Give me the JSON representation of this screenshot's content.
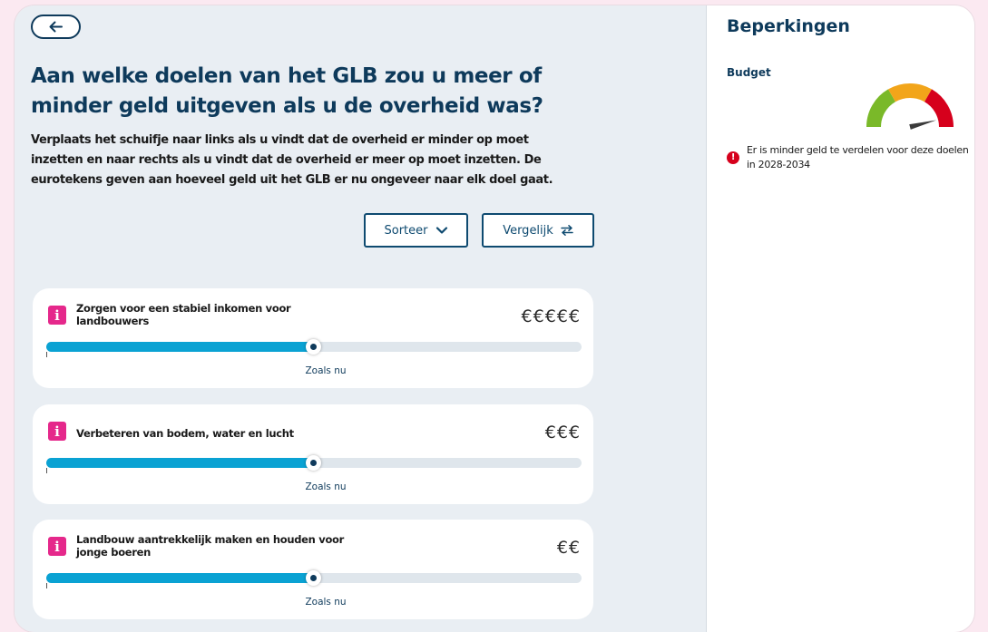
{
  "main": {
    "title": "Aan welke doelen van het GLB zou u meer of minder geld uitgeven als u de overheid was?",
    "intro": "Verplaats het schuifje naar links als u vindt dat de overheid er minder op moet inzetten en naar rechts als u vindt dat de overheid er meer op moet inzetten. De eurotekens geven aan hoeveel geld uit het GLB er nu ongeveer naar elk doel gaat.",
    "sort_label": "Sorteer",
    "compare_label": "Vergelijk",
    "goals": [
      {
        "label": "Zorgen voor een stabiel inkomen voor landbouwers",
        "euros": "€€€€€",
        "slider_value": 0.5,
        "status": "Zoals nu"
      },
      {
        "label": "Verbeteren van bodem, water en lucht",
        "euros": "€€€",
        "slider_value": 0.5,
        "status": "Zoals nu"
      },
      {
        "label": "Landbouw aantrekkelijk maken en houden voor jonge boeren",
        "euros": "€€",
        "slider_value": 0.5,
        "status": "Zoals nu"
      }
    ]
  },
  "sidebar": {
    "title": "Beperkingen",
    "budget_label": "Budget",
    "budget_level": 0.92,
    "gauge_colors": [
      "#7ab929",
      "#f2a51a",
      "#d6001c"
    ],
    "alert_text": "Er is minder geld te verdelen voor deze doelen in 2028-2034"
  },
  "icons": {
    "back": "arrow-left-icon",
    "sort": "chevron-down-icon",
    "compare": "swap-arrows-icon",
    "info": "info-icon",
    "alert": "exclamation-circle-icon"
  },
  "colors": {
    "brand": "#0e3a5b",
    "slider_fill": "#0aa2d3",
    "info_badge": "#e5288b",
    "alert": "#d6001c"
  }
}
